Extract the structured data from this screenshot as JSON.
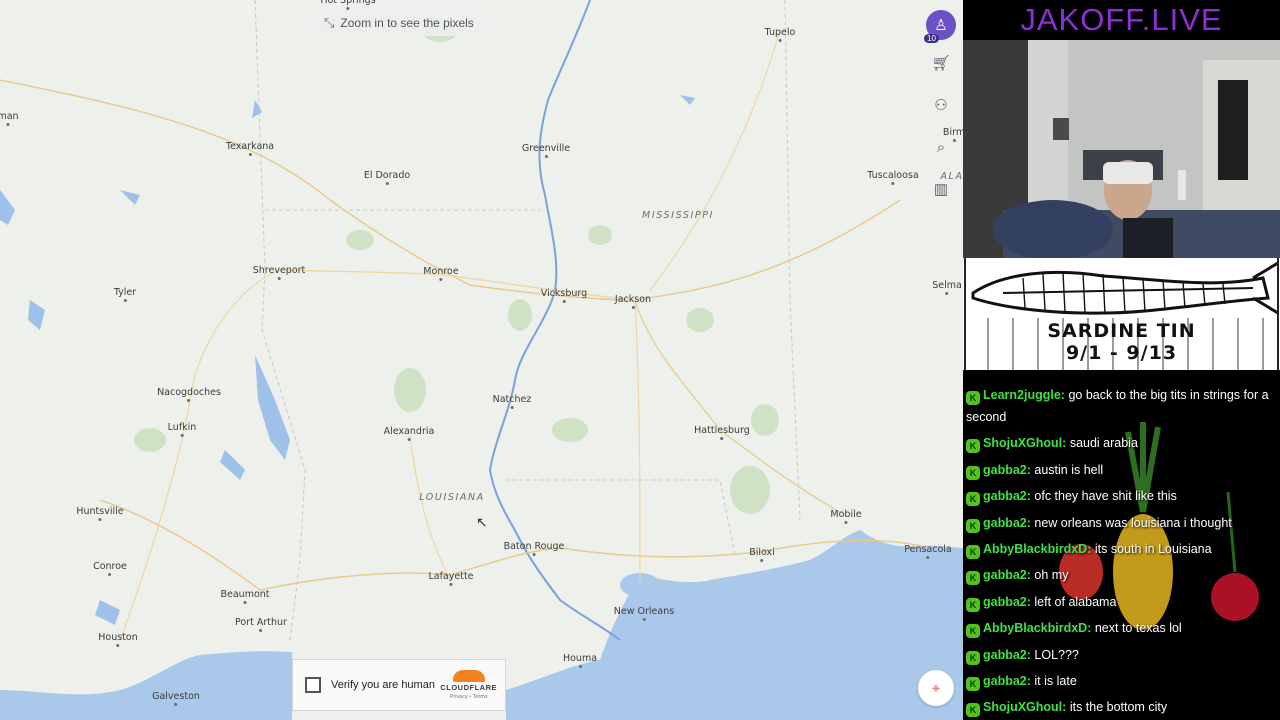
{
  "map": {
    "zoom_hint": "Zoom in to see the pixels",
    "cities": [
      {
        "name": "Hot Springs"
      },
      {
        "name": "Tupelo"
      },
      {
        "name": "Texarkana"
      },
      {
        "name": "Greenville"
      },
      {
        "name": "El Dorado"
      },
      {
        "name": "Tuscaloosa"
      },
      {
        "name": "Birm"
      },
      {
        "name": "Shreveport"
      },
      {
        "name": "Monroe"
      },
      {
        "name": "Tyler"
      },
      {
        "name": "Vicksburg"
      },
      {
        "name": "Jackson"
      },
      {
        "name": "Selma"
      },
      {
        "name": "Nacogdoches"
      },
      {
        "name": "Natchez"
      },
      {
        "name": "Lufkin"
      },
      {
        "name": "Alexandria"
      },
      {
        "name": "Hattiesburg"
      },
      {
        "name": "Huntsville"
      },
      {
        "name": "Mobile"
      },
      {
        "name": "Baton Rouge"
      },
      {
        "name": "Biloxi"
      },
      {
        "name": "Pensacola"
      },
      {
        "name": "Conroe"
      },
      {
        "name": "Lafayette"
      },
      {
        "name": "Beaumont"
      },
      {
        "name": "New Orleans"
      },
      {
        "name": "Port Arthur"
      },
      {
        "name": "Houston"
      },
      {
        "name": "Houma"
      },
      {
        "name": "Galveston"
      },
      {
        "name": "man"
      }
    ],
    "states": [
      {
        "name": "MISSISSIPPI"
      },
      {
        "name": "LOUISIANA"
      },
      {
        "name": "ALA"
      }
    ],
    "captcha": {
      "label": "Verify you are human",
      "brand": "CLOUDFLARE",
      "links": "Privacy • Terms"
    },
    "toolbar": {
      "level": "10",
      "items": [
        "cart-icon",
        "users-icon",
        "search-icon",
        "chart-icon"
      ]
    }
  },
  "stream": {
    "title": "JAKOFF.LIVE",
    "banner": {
      "line1": "SARDINE TIN",
      "line2": "9/1 - 9/13"
    },
    "chat": [
      {
        "user": "Learn2juggle",
        "text": "go back to the big tits in strings for a second"
      },
      {
        "user": "ShojuXGhoul",
        "text": "saudi arabia"
      },
      {
        "user": "gabba2",
        "text": "austin is hell"
      },
      {
        "user": "gabba2",
        "text": "ofc they have shit like this"
      },
      {
        "user": "gabba2",
        "text": "new orleans was louisiana i thought"
      },
      {
        "user": "AbbyBlackbirdxD",
        "text": "its south in Louisiana"
      },
      {
        "user": "gabba2",
        "text": "oh my"
      },
      {
        "user": "gabba2",
        "text": "left of alabama"
      },
      {
        "user": "AbbyBlackbirdxD",
        "text": "next to texas lol"
      },
      {
        "user": "gabba2",
        "text": "LOL???"
      },
      {
        "user": "gabba2",
        "text": "it is late"
      },
      {
        "user": "ShojuXGhoul",
        "text": "its the bottom city"
      }
    ],
    "colors": {
      "title": "#8f2ed6",
      "username": "#3ee244",
      "badge": "#53c21c"
    }
  }
}
